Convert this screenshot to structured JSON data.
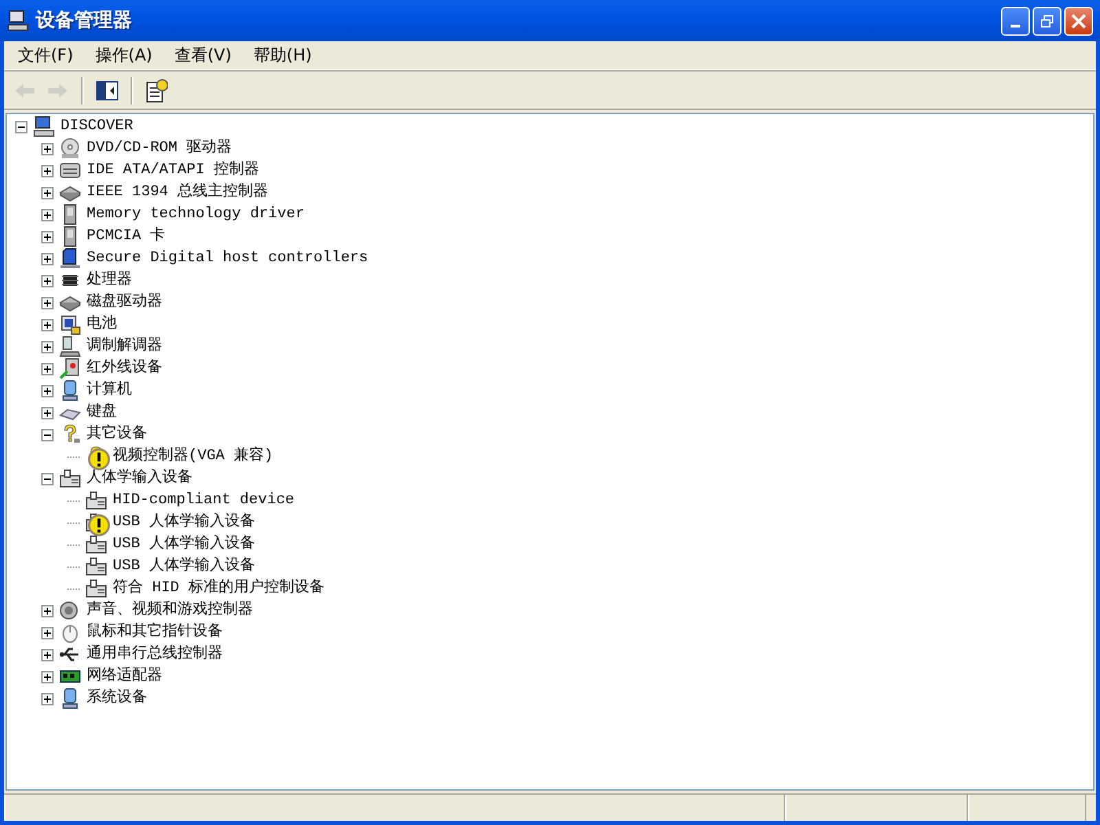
{
  "window": {
    "title": "设备管理器"
  },
  "menu": [
    {
      "label": "文件(F)"
    },
    {
      "label": "操作(A)"
    },
    {
      "label": "查看(V)"
    },
    {
      "label": "帮助(H)"
    }
  ],
  "toolbar": [
    {
      "kind": "back",
      "disabled": true
    },
    {
      "kind": "forward",
      "disabled": true
    },
    {
      "kind": "tree",
      "disabled": false
    },
    {
      "kind": "properties",
      "disabled": false
    }
  ],
  "tree": [
    {
      "label": "DISCOVER",
      "kind": "computer",
      "expanded": true,
      "children": [
        {
          "label": "DVD/CD-ROM 驱动器",
          "kind": "disc",
          "expanded": false
        },
        {
          "label": "IDE ATA/ATAPI 控制器",
          "kind": "controller",
          "expanded": false
        },
        {
          "label": "IEEE 1394 总线主控制器",
          "kind": "bus",
          "expanded": false
        },
        {
          "label": "Memory technology driver",
          "kind": "card",
          "expanded": false
        },
        {
          "label": "PCMCIA 卡",
          "kind": "card",
          "expanded": false
        },
        {
          "label": "Secure Digital host controllers",
          "kind": "sd",
          "expanded": false
        },
        {
          "label": "处理器",
          "kind": "cpu",
          "expanded": false
        },
        {
          "label": "磁盘驱动器",
          "kind": "bus",
          "expanded": false
        },
        {
          "label": "电池",
          "kind": "battery",
          "expanded": false
        },
        {
          "label": "调制解调器",
          "kind": "modem",
          "expanded": false
        },
        {
          "label": "红外线设备",
          "kind": "infrared",
          "expanded": false
        },
        {
          "label": "计算机",
          "kind": "monitor",
          "expanded": false
        },
        {
          "label": "键盘",
          "kind": "keyboard",
          "expanded": false
        },
        {
          "label": "其它设备",
          "kind": "question",
          "expanded": true,
          "children": [
            {
              "label": "视频控制器(VGA 兼容)",
              "kind": "question",
              "warning": true
            }
          ]
        },
        {
          "label": "人体学输入设备",
          "kind": "hid",
          "expanded": true,
          "children": [
            {
              "label": "HID-compliant device",
              "kind": "hid",
              "warning": false
            },
            {
              "label": "USB 人体学输入设备",
              "kind": "hid",
              "warning": true
            },
            {
              "label": "USB 人体学输入设备",
              "kind": "hid",
              "warning": false
            },
            {
              "label": "USB 人体学输入设备",
              "kind": "hid",
              "warning": false
            },
            {
              "label": "符合 HID 标准的用户控制设备",
              "kind": "hid",
              "warning": false
            }
          ]
        },
        {
          "label": "声音、视频和游戏控制器",
          "kind": "sound",
          "expanded": false
        },
        {
          "label": "鼠标和其它指针设备",
          "kind": "mouse",
          "expanded": false
        },
        {
          "label": "通用串行总线控制器",
          "kind": "usb",
          "expanded": false
        },
        {
          "label": "网络适配器",
          "kind": "network",
          "expanded": false
        },
        {
          "label": "系统设备",
          "kind": "monitor",
          "expanded": false
        }
      ]
    }
  ]
}
